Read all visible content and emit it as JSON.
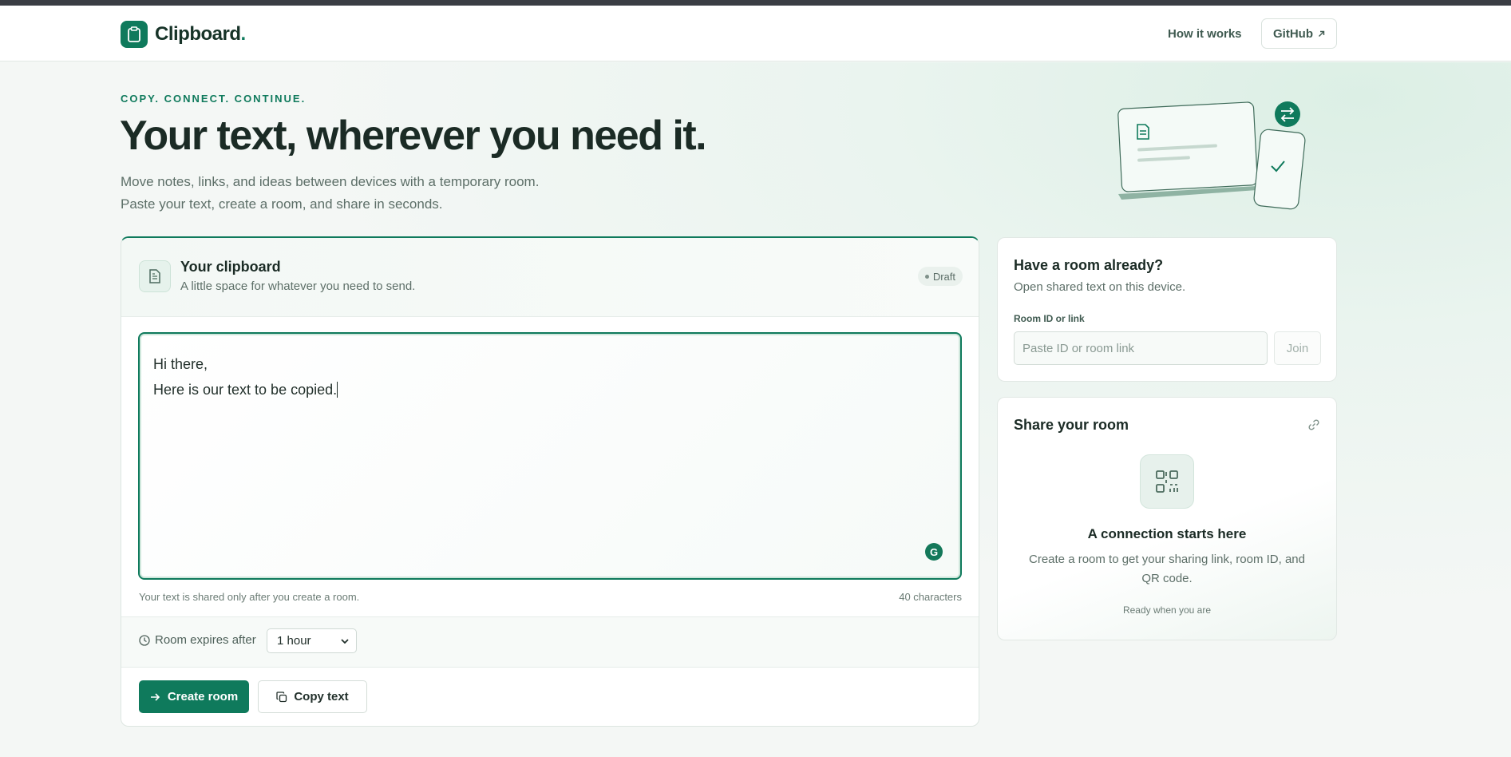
{
  "header": {
    "brand": "Clipboard",
    "brand_dot": ".",
    "nav_how": "How it works",
    "github_label": "GitHub",
    "github_icon": "external-arrow-icon"
  },
  "hero": {
    "eyebrow": "COPY. CONNECT. CONTINUE.",
    "title": "Your text, wherever you need it.",
    "subtitle_line1": "Move notes, links, and ideas between devices with a temporary room.",
    "subtitle_line2": "Paste your text, create a room, and share in seconds."
  },
  "clipboard": {
    "title": "Your clipboard",
    "subtitle": "A little space for whatever you need to send.",
    "badge": "Draft",
    "text_line1": "Hi there,",
    "text_line2": "Here is our text to be copied.",
    "hint": "Your text is shared only after you create a room.",
    "char_count": "40 characters",
    "expire_label": "Room expires after",
    "expire_value": "1 hour",
    "create_label": "Create room",
    "copy_label": "Copy text"
  },
  "join": {
    "title": "Have a room already?",
    "subtitle": "Open shared text on this device.",
    "field_label": "Room ID or link",
    "placeholder": "Paste ID or room link",
    "button": "Join"
  },
  "share": {
    "title": "Share your room",
    "heading": "A connection starts here",
    "description": "Create a room to get your sharing link, room ID, and QR code.",
    "ready": "Ready when you are"
  },
  "colors": {
    "accent": "#0f7a5c",
    "background": "#f4f7f5",
    "text": "#1b2b25"
  }
}
